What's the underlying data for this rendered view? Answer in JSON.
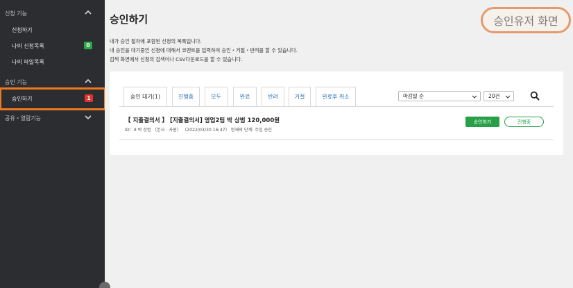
{
  "sidebar": {
    "sections": [
      {
        "label": "신청 기능",
        "expanded": true
      },
      {
        "label": "승인 기능",
        "expanded": true
      },
      {
        "label": "공유・열람기능",
        "expanded": false
      }
    ],
    "items": [
      {
        "label": "신청하기"
      },
      {
        "label": "나의 신청목록",
        "badge": "0",
        "badge_color": "#2aa84a"
      },
      {
        "label": "나의 파일목록"
      },
      {
        "label": "승인하기",
        "badge": "1",
        "badge_color": "#e0342c",
        "active": true
      }
    ]
  },
  "page": {
    "title": "승인하기",
    "description": [
      "내가 승인 절차에 포함된 신청의 목록입니다.",
      "내 승인을 대기중인 신청에 대해서 코멘트를 입력하여 승인・거절・반려를 할 수 있습니다.",
      "검색 화면에서 신청의 검색이나 CSV다운로드를 할 수 있습니다."
    ]
  },
  "overlay_label": "승인유저 화면",
  "tabs": [
    {
      "label": "승인 대기(1)",
      "active": true
    },
    {
      "label": "진행중"
    },
    {
      "label": "모두"
    },
    {
      "label": "완료"
    },
    {
      "label": "반려"
    },
    {
      "label": "거절"
    },
    {
      "label": "완료후 취소"
    }
  ],
  "filters": {
    "sort_selected": "마감일 순",
    "count_selected": "20건"
  },
  "request_item": {
    "title": "【 지출결의서 】 [지출결의서] 영업2팀 박 상범 120,000원",
    "meta": "ID：9   박 상범 （본사 - 사원） （2022/03/30 16:47）   현재의 단계: 주임 승인",
    "approve_label": "승인하기",
    "status_label": "진행중"
  },
  "colors": {
    "accent_orange": "#f0791f",
    "green": "#27a048",
    "sidebar_bg": "#2b2d30"
  }
}
